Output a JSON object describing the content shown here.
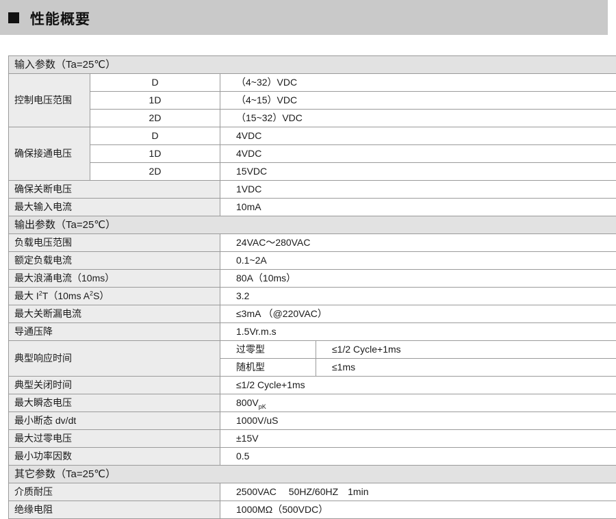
{
  "header": {
    "title": "性能概要"
  },
  "input": {
    "title": "输入参数（Ta=25℃）",
    "control_voltage": {
      "label": "控制电压范围",
      "rows": [
        {
          "model": "D",
          "value": "（4~32）VDC"
        },
        {
          "model": "1D",
          "value": "（4~15）VDC"
        },
        {
          "model": "2D",
          "value": "（15~32）VDC"
        }
      ]
    },
    "on_voltage": {
      "label": "确保接通电压",
      "rows": [
        {
          "model": "D",
          "value": "4VDC"
        },
        {
          "model": "1D",
          "value": "4VDC"
        },
        {
          "model": "2D",
          "value": "15VDC"
        }
      ]
    },
    "off_voltage": {
      "label": "确保关断电压",
      "value": "1VDC"
    },
    "max_current": {
      "label": "最大输入电流",
      "value": "10mA"
    }
  },
  "output": {
    "title": "输出参数（Ta=25℃）",
    "load_voltage": {
      "label": "负载电压范围",
      "value": "24VAC～280VAC"
    },
    "rated_current": {
      "label": "额定负载电流",
      "value": "0.1~2A"
    },
    "surge_current": {
      "label": "最大浪涌电流（10ms）",
      "value": "80A（10ms）"
    },
    "i2t": {
      "label_a": "最大 I",
      "label_sup": "2",
      "label_b": "T（10ms A",
      "label_sup2": "2",
      "label_c": "S）",
      "value": "3.2"
    },
    "leakage": {
      "label": "最大关断漏电流",
      "value": "≤3mA （@220VAC）"
    },
    "drop": {
      "label": "导通压降",
      "value": "1.5Vr.m.s"
    },
    "response": {
      "label": "典型响应时间",
      "rows": [
        {
          "type": "过零型",
          "value": "≤1/2 Cycle+1ms"
        },
        {
          "type": "随机型",
          "value": "≤1ms"
        }
      ]
    },
    "off_time": {
      "label": "典型关闭时间",
      "value": "≤1/2 Cycle+1ms"
    },
    "transient": {
      "label": "最大瞬态电压",
      "value": "800V",
      "value_sub": "pK"
    },
    "dvdt": {
      "label": "最小断态 dv/dt",
      "value": "1000V/uS"
    },
    "zero_cross": {
      "label": "最大过零电压",
      "value": "±15V"
    },
    "power_factor": {
      "label": "最小功率因数",
      "value": "0.5"
    }
  },
  "other": {
    "title": "其它参数（Ta=25℃）",
    "dielectric": {
      "label": "介质耐压",
      "value": "2500VAC　 50HZ/60HZ　1min"
    },
    "insulation": {
      "label": "绝缘电阻",
      "value": "1000MΩ（500VDC）"
    }
  }
}
